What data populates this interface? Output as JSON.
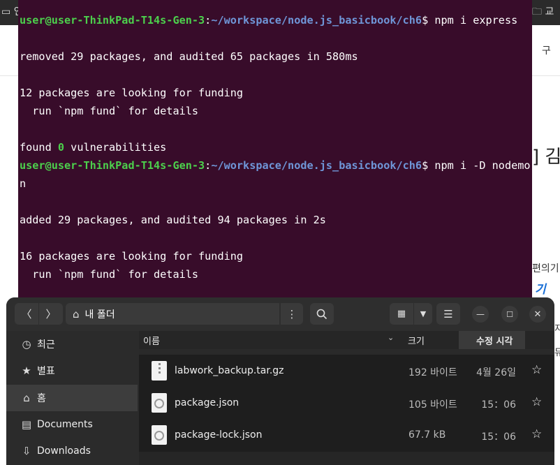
{
  "background": {
    "tab_left": "인",
    "tab_right": "교",
    "right_glyph": "구",
    "heading_fragment": "] 김",
    "side_text_1": "편의기",
    "link_text": "기",
    "side_text_2": "지",
    "side_text_3": "듀"
  },
  "terminal": {
    "prompt_user": "user@user-ThinkPad-T14s-Gen-3",
    "prompt_path": "~/workspace/node.js_basicbook/ch6",
    "cmd1": "npm i express",
    "out1": "removed 29 packages, and audited 65 packages in 580ms",
    "out2": "12 packages are looking for funding",
    "out3": "  run `npm fund` for details",
    "out4_pre": "found ",
    "out4_num": "0",
    "out4_post": " vulnerabilities",
    "cmd2": "npm i -D nodemo",
    "cmd2_wrap": "n",
    "out5": "added 29 packages, and audited 94 packages in 2s",
    "out6": "16 packages are looking for funding",
    "out7": "  run `npm fund` for details"
  },
  "file_manager": {
    "location": "내 폴더",
    "sidebar": [
      {
        "icon": "clock-icon",
        "label": "최근"
      },
      {
        "icon": "star-icon",
        "label": "별표"
      },
      {
        "icon": "home-icon",
        "label": "홈"
      },
      {
        "icon": "documents-icon",
        "label": "Documents"
      },
      {
        "icon": "download-icon",
        "label": "Downloads"
      }
    ],
    "columns": {
      "name": "이름",
      "size": "크기",
      "modified": "수정 시각"
    },
    "files": [
      {
        "name": "labwork_backup.tar.gz",
        "size": "192 바이트",
        "modified": "4월 26일",
        "icon": "archive-icon"
      },
      {
        "name": "package.json",
        "size": "105 바이트",
        "modified": "15：06",
        "icon": "json-file-icon"
      },
      {
        "name": "package-lock.json",
        "size": "67.7 kB",
        "modified": "15：06",
        "icon": "json-file-icon"
      }
    ]
  }
}
